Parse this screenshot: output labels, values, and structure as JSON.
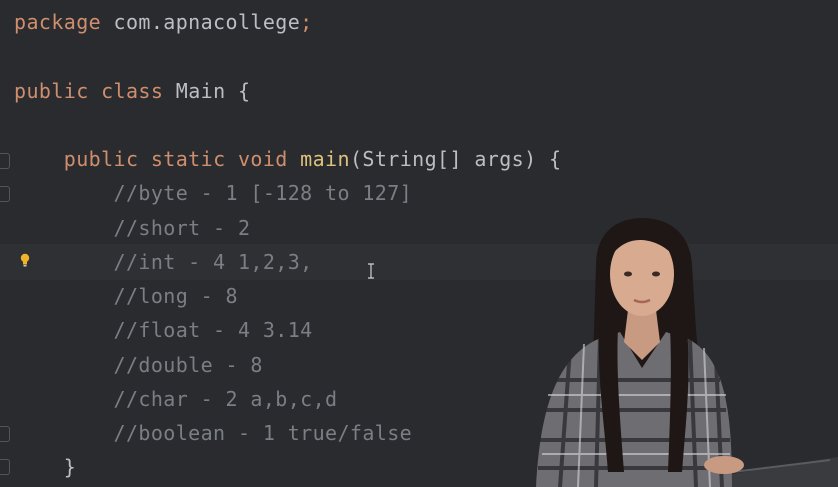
{
  "code": {
    "lines": [
      {
        "parts": [
          {
            "t": "package ",
            "c": "kw"
          },
          {
            "t": "com.apnacollege",
            "c": "tx"
          },
          {
            "t": ";",
            "c": "kw"
          }
        ]
      },
      {
        "parts": [
          {
            "t": "public ",
            "c": "kw"
          },
          {
            "t": "class ",
            "c": "kw"
          },
          {
            "t": "Main {",
            "c": "tx"
          }
        ]
      },
      {
        "parts": [
          {
            "t": "    public ",
            "c": "kw"
          },
          {
            "t": "static ",
            "c": "kw"
          },
          {
            "t": "void ",
            "c": "kw"
          },
          {
            "t": "main",
            "c": "mn"
          },
          {
            "t": "(String[] args) {",
            "c": "tx"
          }
        ]
      },
      {
        "parts": [
          {
            "t": "        //byte - 1 [-128 to 127]",
            "c": "cm"
          }
        ]
      },
      {
        "parts": [
          {
            "t": "        //short - 2",
            "c": "cm"
          }
        ]
      },
      {
        "parts": [
          {
            "t": "        //int - 4 1,2,3,",
            "c": "cm"
          }
        ]
      },
      {
        "parts": [
          {
            "t": "        //long - 8",
            "c": "cm"
          }
        ]
      },
      {
        "parts": [
          {
            "t": "        //float - 4 3.14",
            "c": "cm"
          }
        ]
      },
      {
        "parts": [
          {
            "t": "        //double - 8",
            "c": "cm"
          }
        ]
      },
      {
        "parts": [
          {
            "t": "        //char - 2 a,b,c,d",
            "c": "cm"
          }
        ]
      },
      {
        "parts": [
          {
            "t": "        //boolean - 1 true/false",
            "c": "cm"
          }
        ]
      },
      {
        "parts": [
          {
            "t": "    }",
            "c": "tx"
          }
        ]
      }
    ]
  },
  "icons": {
    "bulb": "lightbulb-icon",
    "cursor": "text-cursor-icon"
  },
  "colors": {
    "background": "#2a2b2e",
    "keyword": "#cf8e6d",
    "method": "#dcc27e",
    "text": "#bcbec4",
    "comment": "#7a7e85",
    "bulb": "#f0b429"
  }
}
